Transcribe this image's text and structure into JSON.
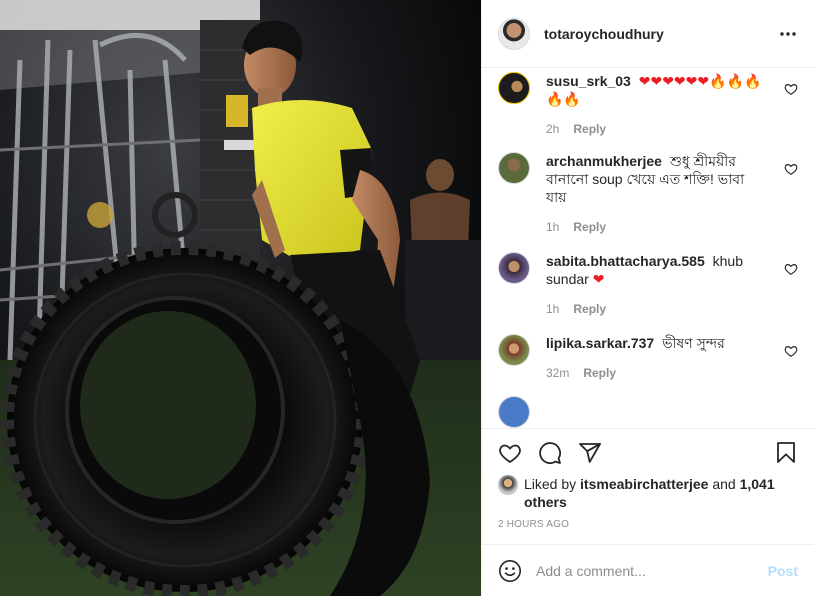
{
  "post": {
    "author": "totaroychoudhury",
    "more_icon": "more-horizontal-icon"
  },
  "comments": [
    {
      "username": "susu_srk_03",
      "text": "",
      "emoji": "❤❤❤❤❤❤🔥🔥🔥🔥🔥",
      "time": "2h",
      "reply": "Reply",
      "avatar_color": "#3a2a2a"
    },
    {
      "username": "archanmukherjee",
      "text": "শুধু শ্রীময়ীর বানানো soup খেয়ে এত শক্তি! ভাবা যায়",
      "time": "1h",
      "reply": "Reply",
      "avatar_color": "#4a5a3a"
    },
    {
      "username": "sabita.bhattacharya.585",
      "text": "khub sundar",
      "emoji": "❤",
      "time": "1h",
      "reply": "Reply",
      "avatar_color": "#5a4a6a"
    },
    {
      "username": "lipika.sarkar.737",
      "text": "ভীষণ সুন্দর",
      "time": "32m",
      "reply": "Reply",
      "avatar_color": "#6a7a4a"
    }
  ],
  "actions": {
    "like_icon": "heart-icon",
    "comment_icon": "comment-icon",
    "share_icon": "share-icon",
    "save_icon": "bookmark-icon"
  },
  "likes": {
    "prefix": "Liked by",
    "user": "itsmeabirchatterjee",
    "and": "and",
    "others": "1,041 others"
  },
  "timestamp": "2 HOURS AGO",
  "add_comment": {
    "placeholder": "Add a comment...",
    "post_label": "Post"
  },
  "colors": {
    "shirt": "#e8e43a",
    "post_disabled": "#b2dffc",
    "meta": "#8e8e8e"
  }
}
